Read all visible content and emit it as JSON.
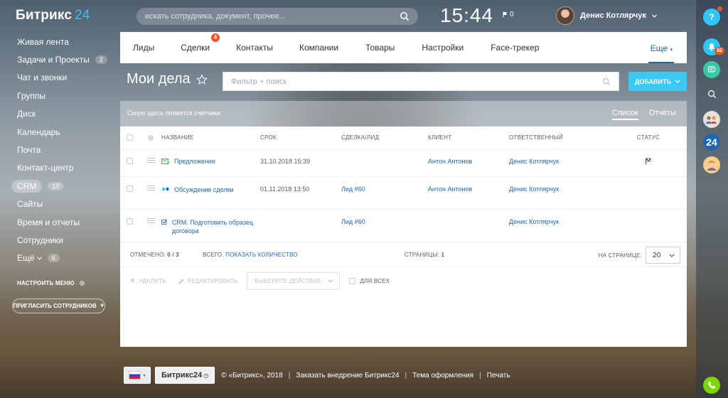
{
  "header": {
    "logo_main": "Битрикс",
    "logo_accent": "24",
    "search_placeholder": "искать сотрудника, документ, прочее...",
    "time": "15:44",
    "flag_count": "0",
    "user_name": "Денис Котлярчук"
  },
  "left_menu": {
    "items": [
      {
        "label": "Живая лента"
      },
      {
        "label": "Задачи и Проекты",
        "count": "2"
      },
      {
        "label": "Чат и звонки"
      },
      {
        "label": "Группы"
      },
      {
        "label": "Диск"
      },
      {
        "label": "Календарь"
      },
      {
        "label": "Почта"
      },
      {
        "label": "Контакт-центр"
      },
      {
        "label": "CRM",
        "count": "10"
      },
      {
        "label": "Сайты"
      },
      {
        "label": "Время и отчеты"
      },
      {
        "label": "Сотрудники"
      },
      {
        "label": "Ещё",
        "count": "6"
      }
    ],
    "settings_label": "НАСТРОИТЬ МЕНЮ",
    "invite_label": "ПРИГЛАСИТЬ СОТРУДНИКОВ"
  },
  "tabs": {
    "items": [
      {
        "label": "Лиды"
      },
      {
        "label": "Сделки",
        "badge": "4"
      },
      {
        "label": "Контакты"
      },
      {
        "label": "Компании"
      },
      {
        "label": "Товары"
      },
      {
        "label": "Настройки"
      },
      {
        "label": "Face-трекер"
      }
    ],
    "more_label": "Еще"
  },
  "page": {
    "title": "Мои дела",
    "filter_placeholder": "Фильтр + поиск",
    "add_label": "ДОБАВИТЬ",
    "counters_text": "Скоро здесь появятся счетчики",
    "view_list": "Список",
    "view_reports": "Отчёты"
  },
  "grid": {
    "columns": [
      "НАЗВАНИЕ",
      "СРОК",
      "СДЕЛКА/ЛИД",
      "КЛИЕНТ",
      "ОТВЕТСТВЕННЫЙ",
      "СТАТУС"
    ],
    "rows": [
      {
        "name": "Предложение",
        "icon": "email-icon",
        "date": "31.10.2018 15:39",
        "deal": "",
        "client": "Антон Антонов",
        "owner": "Денис Котлярчук",
        "status_icon": "flag-icon"
      },
      {
        "name": "Обсуждение сделки",
        "icon": "meeting-icon",
        "date": "01.11.2018 13:50",
        "deal": "Лид #60",
        "client": "Антон Антонов",
        "owner": "Денис Котлярчук",
        "status_icon": ""
      },
      {
        "name": "CRM. Подготовить образец договора",
        "icon": "task-icon",
        "date": "",
        "deal": "Лид #60",
        "client": "",
        "owner": "Денис Котлярчук",
        "status_icon": ""
      }
    ],
    "footer": {
      "selected_label": "ОТМЕЧЕНО:",
      "selected_value": "0 / 3",
      "total_label": "ВСЕГО:",
      "total_link": "ПОКАЗАТЬ КОЛИЧЕСТВО",
      "pages_label": "СТРАНИЦЫ:",
      "pages_value": "1",
      "per_page_label": "НА СТРАНИЦЕ:",
      "per_page_value": "20"
    },
    "actions": {
      "delete_label": "УДАЛИТЬ",
      "edit_label": "РЕДАКТИРОВАТЬ",
      "select_label": "ВЫБЕРИТЕ ДЕЙСТВИЕ",
      "for_all_label": "ДЛЯ ВСЕХ"
    }
  },
  "footer": {
    "brand_label": "Битрикс24",
    "copyright": "© «Битрикс», 2018",
    "order_link": "Заказать внедрение Битрикс24",
    "theme_link": "Тема оформления",
    "print_link": "Печать"
  },
  "right_bar": {
    "help_label": "?",
    "notify_count": "82",
    "b24_label": "24"
  },
  "colors": {
    "accent": "#2fc6f6",
    "link": "#2067b0",
    "badge": "#f45228",
    "add_button": "#3bc8f5"
  }
}
